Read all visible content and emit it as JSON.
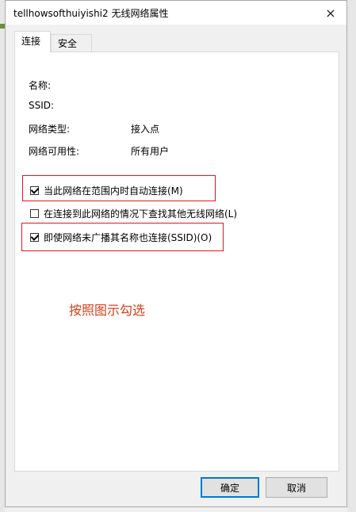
{
  "window": {
    "title": "tellhowsofthuiyishi2 无线网络属性",
    "close_icon": "×"
  },
  "tabs": [
    {
      "label": "连接",
      "active": true
    },
    {
      "label": "安全",
      "active": false
    }
  ],
  "info": [
    {
      "label": "名称:",
      "value": ""
    },
    {
      "label": "SSID:",
      "value": ""
    },
    {
      "label": "网络类型:",
      "value": "接入点"
    },
    {
      "label": "网络可用性:",
      "value": "所有用户"
    }
  ],
  "options": [
    {
      "label": "当此网络在范围内时自动连接(M)",
      "checked": true
    },
    {
      "label": "在连接到此网络的情况下查找其他无线网络(L)",
      "checked": false
    },
    {
      "label": "即使网络未广播其名称也连接(SSID)(O)",
      "checked": true
    }
  ],
  "instruction": "按照图示勾选",
  "buttons": {
    "ok": "确定",
    "cancel": "取消"
  },
  "colors": {
    "annotation_red": "#e8141c",
    "instruction_text": "#d4401c",
    "primary_border": "#0078d7"
  }
}
